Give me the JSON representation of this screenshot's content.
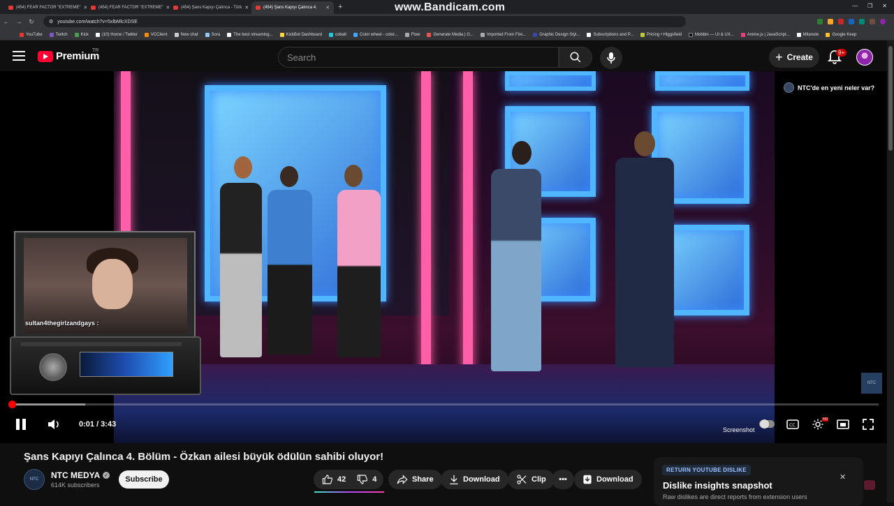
{
  "browser": {
    "watermark": "www.Bandicam.com",
    "tabs": [
      {
        "title": "(454) FEAR FACTOR \"EXTREME\"",
        "active": false
      },
      {
        "title": "(454) FEAR FACTOR \"EXTREME\"",
        "active": false
      },
      {
        "title": "(454) Şans Kapıyı Çalınca - Türk",
        "active": false
      },
      {
        "title": "(454) Şans Kapıyı Çalınca 4.",
        "active": true
      }
    ],
    "url": "youtube.com/watch?v=5xlbMlcXDSE",
    "bookmarks": [
      "YouTube",
      "Twitch",
      "Kick",
      "(10) Home / Twitter",
      "VCClient",
      "New chat",
      "Sora",
      "The best streaming...",
      "KickBot Dashboard",
      "cobalt",
      "Color wheel - color...",
      "Flow",
      "Generate Media | G...",
      "Imported From Fire...",
      "Graphic Design Styl...",
      "Subscriptions and P...",
      "Pricing • Higgsfield",
      "Mobbin — UI & UX...",
      "Anime.js | JavaScript...",
      "Milanote",
      "Google Keep"
    ]
  },
  "header": {
    "logo_text": "Premium",
    "country": "TR",
    "search_placeholder": "Search",
    "create_label": "Create",
    "notif_count": "9+"
  },
  "player": {
    "channel_card": "NTC'de en yeni neler var?",
    "watermark": "NTC",
    "overlay_chat": "sultan4thegirlzandgays :",
    "time": "0:01 / 3:43",
    "played_fraction": 0.004,
    "buffered_fraction": 0.088,
    "screenshot_label": "Screenshot",
    "hd_badge": "HD"
  },
  "video": {
    "title": "Şans Kapıyı Çalınca 4. Bölüm - Özkan ailesi büyük ödülün sahibi oluyor!",
    "channel": "NTC MEDYA",
    "channel_avatar": "NTC",
    "subscribers": "614K subscribers",
    "subscribe_label": "Subscribe",
    "likes": "42",
    "dislikes": "4",
    "share_label": "Share",
    "download_label": "Download",
    "clip_label": "Clip",
    "download2_label": "Download"
  },
  "ryd": {
    "tag": "RETURN YOUTUBE DISLIKE",
    "title": "Dislike insights snapshot",
    "subtitle": "Raw dislikes are direct reports from extension users"
  },
  "colors": {
    "brand_red": "#ff0033",
    "accent_pink": "#ff5ea8",
    "panel_blue": "#4fb6ff"
  }
}
